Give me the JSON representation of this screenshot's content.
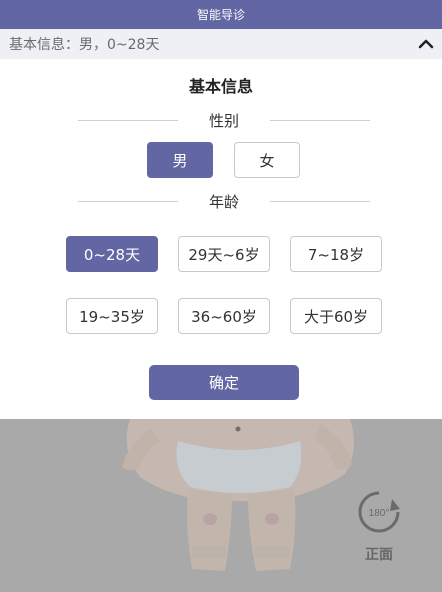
{
  "header": {
    "title": "智能导诊"
  },
  "info_bar": {
    "text": "基本信息：男，0~28天"
  },
  "panel": {
    "title": "基本信息",
    "gender_section": {
      "label": "性别",
      "options": [
        "男",
        "女"
      ],
      "selected": "男"
    },
    "age_section": {
      "label": "年龄",
      "options": [
        "0~28天",
        "29天~6岁",
        "7~18岁",
        "19~35岁",
        "36~60岁",
        "大于60岁"
      ],
      "selected": "0~28天"
    },
    "confirm_label": "确定"
  },
  "body_view": {
    "rotate_badge": "180°",
    "rotate_label": "正面"
  },
  "colors": {
    "accent": "#6266a3",
    "info_bar_bg": "#eef0f5",
    "backdrop": "#a9a9a9"
  }
}
